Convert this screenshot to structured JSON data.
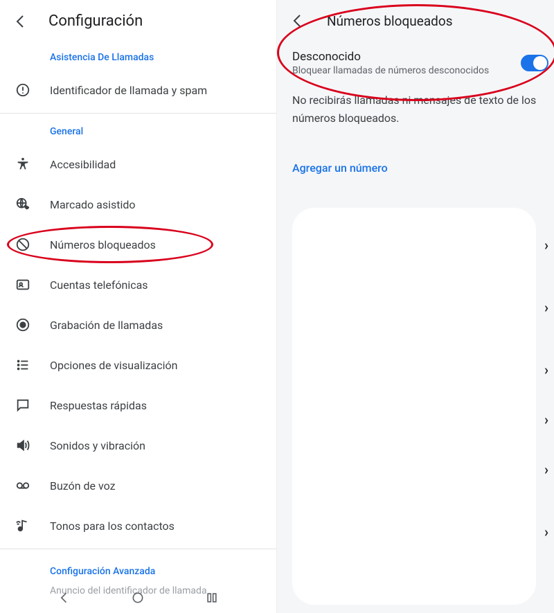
{
  "left": {
    "title": "Configuración",
    "section1": "Asistencia De Llamadas",
    "callerId": "Identificador de llamada y spam",
    "section2": "General",
    "items": [
      "Accesibilidad",
      "Marcado asistido",
      "Números bloqueados",
      "Cuentas telefónicas",
      "Grabación de llamadas",
      "Opciones de visualización",
      "Respuestas rápidas",
      "Sonidos y vibración",
      "Buzón de voz",
      "Tonos para los contactos"
    ],
    "advanced": "Configuración Avanzada",
    "fade": "Anuncio del identificador de llamada"
  },
  "right": {
    "title": "Números bloqueados",
    "unknownTitle": "Desconocido",
    "unknownSub": "Bloquear llamadas de números desconocidos",
    "info": "No recibirás llamadas ni mensajes de texto de los números bloqueados.",
    "addNumber": "Agregar un número"
  }
}
